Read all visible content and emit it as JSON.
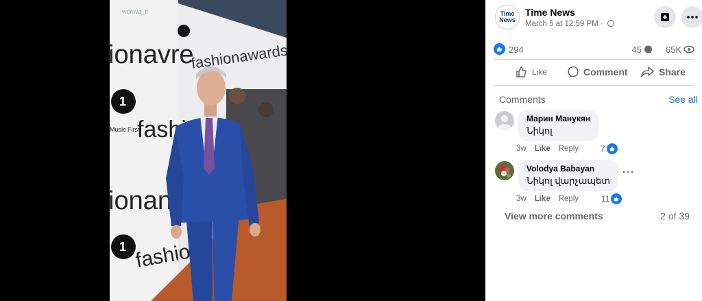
{
  "photo": {
    "watermark": "wemva_tl",
    "backdrop_text": [
      "fashionawards",
      "ionavre",
      "fashi",
      "ionanc",
      "fashion",
      "Music First",
      "VH1"
    ]
  },
  "post": {
    "page_name": "Time News",
    "logo_text_1": "Time",
    "logo_text_2": "News",
    "timestamp": "March 5 at 12:59 PM",
    "separator": " · ",
    "reactions": "294",
    "comments": "45",
    "views": "65K"
  },
  "actions": {
    "like": "Like",
    "comment": "Comment",
    "share": "Share"
  },
  "comments_section": {
    "title": "Comments",
    "see_all": "See all",
    "items": [
      {
        "author": "Марин Манукян",
        "text": "Նիկոլ",
        "age": "3w",
        "like": "Like",
        "reply": "Reply",
        "likes": "7"
      },
      {
        "author": "Volodya Babayan",
        "text": "Նիկոլ վարչապետ",
        "age": "3w",
        "like": "Like",
        "reply": "Reply",
        "likes": "11"
      }
    ],
    "view_more": "View more comments",
    "pager": "2 of 39"
  },
  "colors": {
    "accent": "#1877f2",
    "suit": "#2a4fa8",
    "carpet": "#b85a2a"
  }
}
